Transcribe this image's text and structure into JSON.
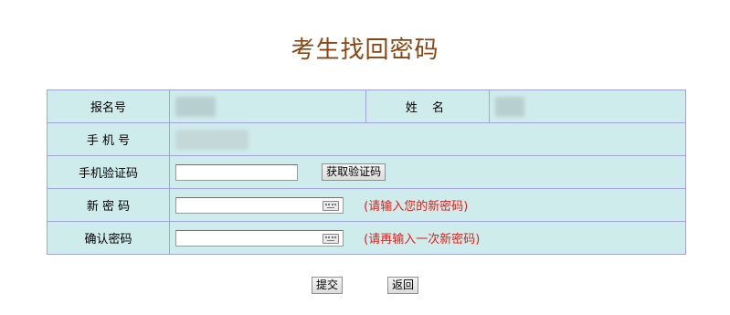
{
  "page": {
    "title": "考生找回密码"
  },
  "form": {
    "reg_no_label": "报名号",
    "name_label": "姓 名",
    "phone_label": "手 机 号",
    "code_label": "手机验证码",
    "code_value": "",
    "get_code_button": "获取验证码",
    "new_pwd_label": "新 密 码",
    "new_pwd_value": "",
    "new_pwd_hint": "(请输入您的新密码)",
    "confirm_pwd_label": "确认密码",
    "confirm_pwd_value": "",
    "confirm_pwd_hint": "(请再输入一次新密码)"
  },
  "actions": {
    "submit_label": "提交",
    "back_label": "返回"
  },
  "icons": {
    "password_keyboard": "keyboard-icon"
  },
  "colors": {
    "title": "#8b4513",
    "table_bg": "#cfeced",
    "table_border": "#a3a3df",
    "hint": "#e0201a"
  }
}
